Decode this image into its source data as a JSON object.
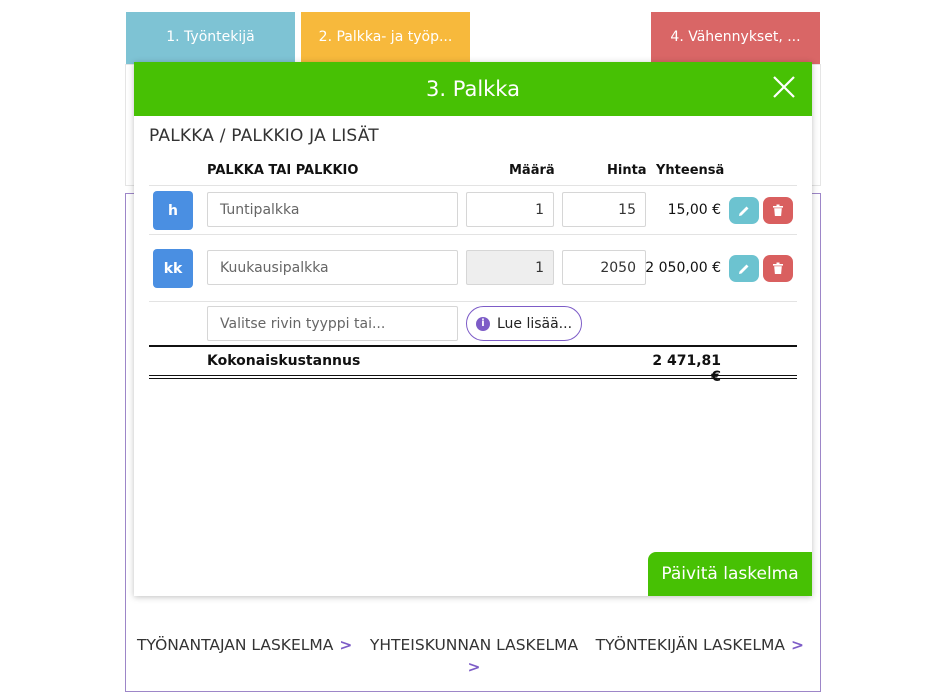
{
  "tabs": {
    "tab1": "1. Työntekijä",
    "tab2": "2. Palkka- ja työp...",
    "tab4": "4. Vähennykset, ..."
  },
  "modal": {
    "title": "3. Palkka",
    "section_title": "PALKKA / PALKKIO JA LISÄT",
    "headers": {
      "name": "PALKKA TAI PALKKIO",
      "qty": "Määrä",
      "price": "Hinta",
      "total": "Yhteensä"
    },
    "rows": [
      {
        "badge": "h",
        "name_placeholder": "Tuntipalkka",
        "qty": "1",
        "price": "15",
        "total": "15,00 €",
        "qty_disabled": false
      },
      {
        "badge": "kk",
        "name_placeholder": "Kuukausipalkka",
        "qty": "1",
        "price": "2050",
        "total": "2 050,00 €",
        "qty_disabled": true
      }
    ],
    "new_row_placeholder": "Valitse rivin tyyppi tai...",
    "read_more": "Lue lisää...",
    "total_label": "Kokonaiskustannus",
    "total_value": "2 471,81 €",
    "update_button": "Päivitä laskelma"
  },
  "bottom_links": {
    "employer": "TYÖNANTAJAN LASKELMA",
    "society": "YHTEISKUNNAN LASKELMA",
    "employee": "TYÖNTEKIJÄN LASKELMA",
    "chevron": ">"
  },
  "colors": {
    "header_green": "#47c104",
    "tab_blue": "#7ec3d4",
    "tab_yellow": "#f7b93c",
    "tab_red": "#d96666",
    "badge_blue": "#4a8fe2",
    "accent_purple": "#7d5cc7"
  },
  "icons": {
    "close": "close-icon",
    "edit": "pencil-icon",
    "delete": "trash-icon",
    "info": "info-icon"
  }
}
